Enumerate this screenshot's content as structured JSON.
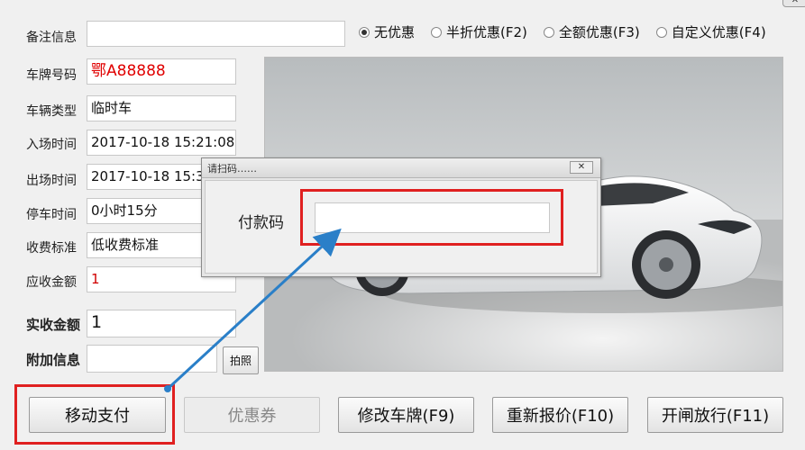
{
  "window": {
    "close_glyph": "✕"
  },
  "form": {
    "remark_label": "备注信息",
    "remark_value": "",
    "plate_label": "车牌号码",
    "plate_value": "鄂A88888",
    "type_label": "车辆类型",
    "type_value": "临时车",
    "entry_label": "入场时间",
    "entry_value": "2017-10-18 15:21:08",
    "exit_label": "出场时间",
    "exit_value": "2017-10-18 15:36",
    "duration_label": "停车时间",
    "duration_value": "0小时15分",
    "standard_label": "收费标准",
    "standard_value": "低收费标准",
    "due_label": "应收金额",
    "due_value": "1",
    "paid_label": "实收金额",
    "paid_value": "1",
    "extra_label": "附加信息",
    "extra_value": ""
  },
  "discount": {
    "options": [
      "无优惠",
      "半折优惠(F2)",
      "全额优惠(F3)",
      "自定义优惠(F4)"
    ],
    "selected": "无优惠"
  },
  "buttons": {
    "photo": "拍照",
    "mobile_pay": "移动支付",
    "coupon": "优惠券",
    "edit_plate": "修改车牌(F9)",
    "requote": "重新报价(F10)",
    "open_gate": "开闸放行(F11)"
  },
  "dialog": {
    "title": "请扫码……",
    "close_glyph": "✕",
    "code_label": "付款码",
    "code_value": ""
  },
  "colors": {
    "plate_red": "#e00000",
    "due_red": "#d00000",
    "highlight_red": "#e02020",
    "arrow_blue": "#2a7fc8"
  }
}
